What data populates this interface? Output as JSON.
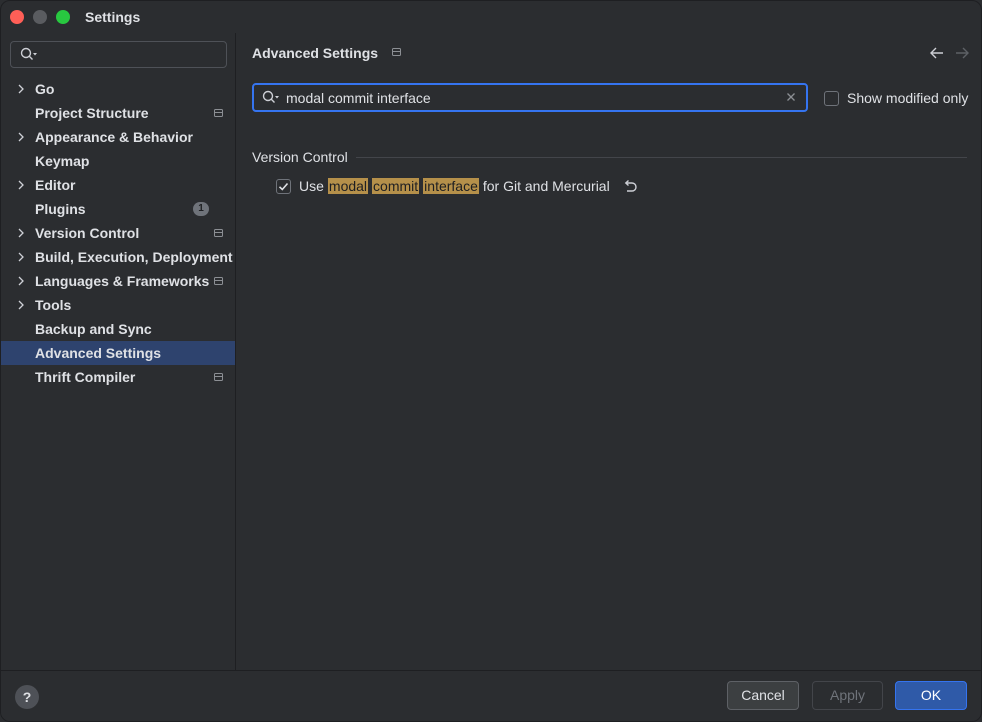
{
  "window": {
    "title": "Settings"
  },
  "sidebar": {
    "search_placeholder": "",
    "items": [
      {
        "label": "Go",
        "expandable": true,
        "pinned": false
      },
      {
        "label": "Project Structure",
        "expandable": false,
        "pinned": true
      },
      {
        "label": "Appearance & Behavior",
        "expandable": true,
        "pinned": false
      },
      {
        "label": "Keymap",
        "expandable": false,
        "pinned": false
      },
      {
        "label": "Editor",
        "expandable": true,
        "pinned": false
      },
      {
        "label": "Plugins",
        "expandable": false,
        "pinned": false,
        "badge": "1"
      },
      {
        "label": "Version Control",
        "expandable": true,
        "pinned": true
      },
      {
        "label": "Build, Execution, Deployment",
        "expandable": true,
        "pinned": false
      },
      {
        "label": "Languages & Frameworks",
        "expandable": true,
        "pinned": true
      },
      {
        "label": "Tools",
        "expandable": true,
        "pinned": false
      },
      {
        "label": "Backup and Sync",
        "expandable": false,
        "pinned": false
      },
      {
        "label": "Advanced Settings",
        "expandable": false,
        "pinned": false,
        "selected": true
      },
      {
        "label": "Thrift Compiler",
        "expandable": false,
        "pinned": true
      }
    ]
  },
  "main": {
    "title": "Advanced Settings",
    "filter": {
      "value": "modal commit interface"
    },
    "show_modified_only": {
      "label": "Show modified only",
      "checked": false
    },
    "groups": [
      {
        "title": "Version Control",
        "settings": [
          {
            "checked": true,
            "words": [
              {
                "text": "Use",
                "highlight": false
              },
              {
                "text": "modal",
                "highlight": true
              },
              {
                "text": "commit",
                "highlight": true
              },
              {
                "text": "interface",
                "highlight": true
              },
              {
                "text": "for Git and Mercurial",
                "highlight": false
              }
            ]
          }
        ]
      }
    ]
  },
  "footer": {
    "help_label": "?",
    "cancel_label": "Cancel",
    "apply_label": "Apply",
    "ok_label": "OK"
  },
  "colors": {
    "background": "#2b2d30",
    "selection": "#2e436e",
    "accent": "#3574f0",
    "highlight": "#b5904a"
  }
}
